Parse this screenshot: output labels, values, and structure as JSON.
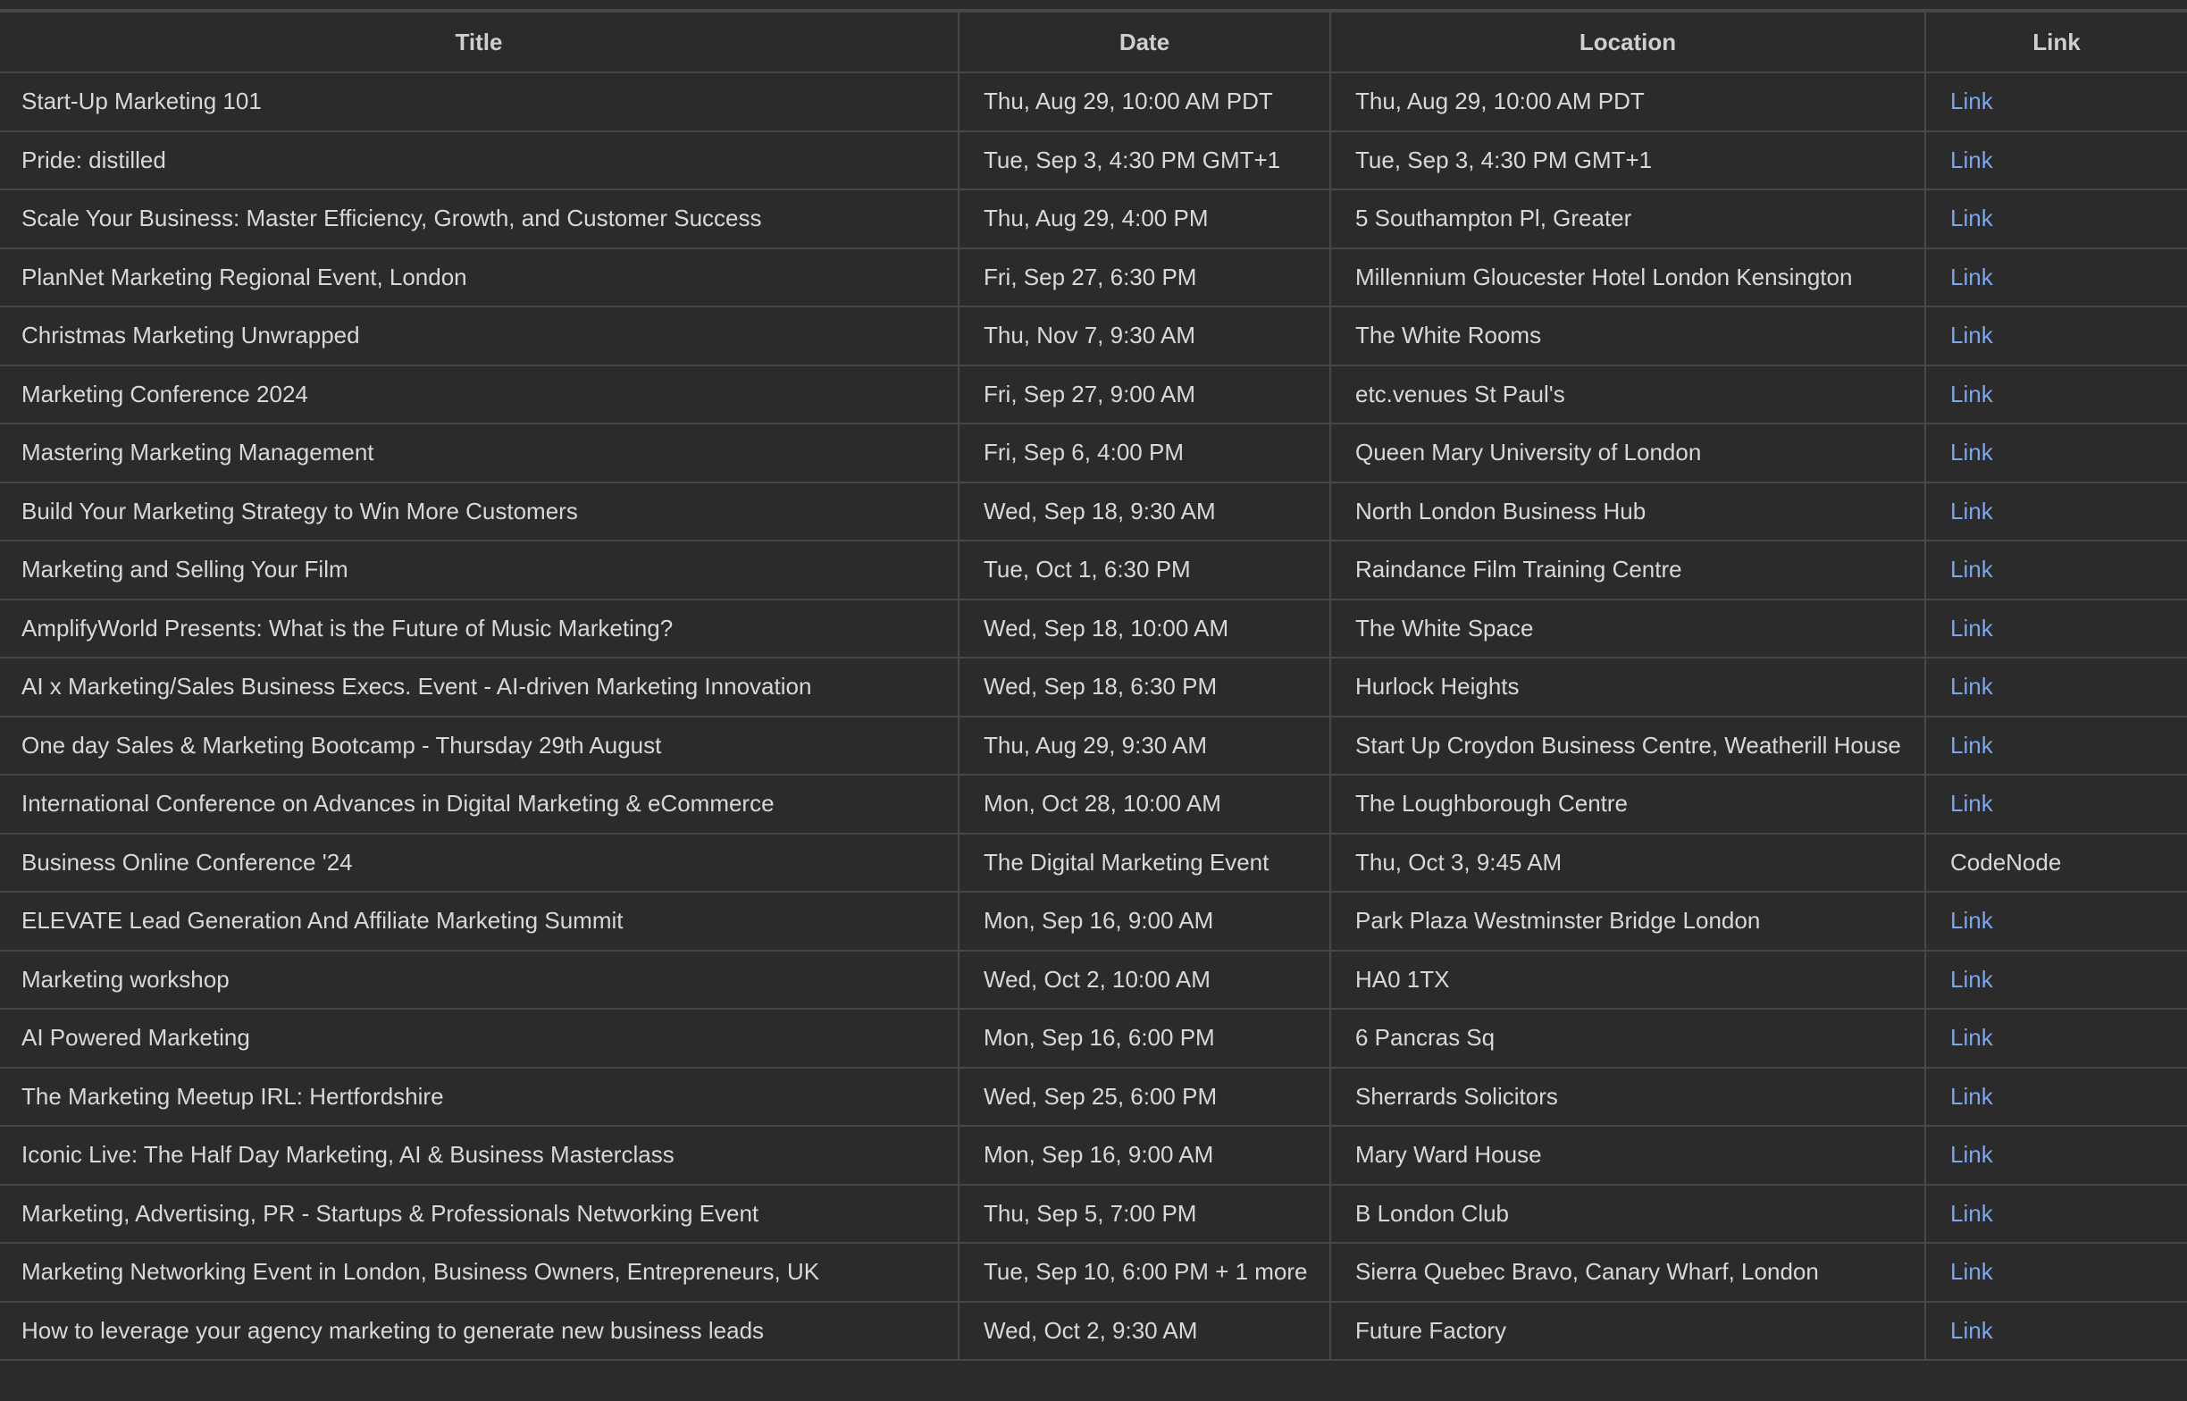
{
  "headers": {
    "title": "Title",
    "date": "Date",
    "location": "Location",
    "link": "Link"
  },
  "rows": [
    {
      "title": "Start-Up Marketing 101",
      "date": "Thu, Aug 29, 10:00 AM PDT",
      "location": "Thu, Aug 29, 10:00 AM PDT",
      "link": "Link",
      "is_link": true
    },
    {
      "title": "Pride: distilled",
      "date": "Tue, Sep 3, 4:30 PM GMT+1",
      "location": "Tue, Sep 3, 4:30 PM GMT+1",
      "link": "Link",
      "is_link": true
    },
    {
      "title": "Scale Your Business: Master Efficiency, Growth, and Customer Success",
      "date": "Thu, Aug 29, 4:00 PM",
      "location": "5 Southampton Pl, Greater",
      "link": "Link",
      "is_link": true
    },
    {
      "title": "PlanNet Marketing Regional Event, London",
      "date": "Fri, Sep 27, 6:30 PM",
      "location": "Millennium Gloucester Hotel London Kensington",
      "link": "Link",
      "is_link": true
    },
    {
      "title": "Christmas Marketing Unwrapped",
      "date": "Thu, Nov 7, 9:30 AM",
      "location": "The White Rooms",
      "link": "Link",
      "is_link": true
    },
    {
      "title": "Marketing Conference 2024",
      "date": "Fri, Sep 27, 9:00 AM",
      "location": "etc.venues St Paul's",
      "link": "Link",
      "is_link": true
    },
    {
      "title": "Mastering Marketing Management",
      "date": "Fri, Sep 6, 4:00 PM",
      "location": "Queen Mary University of London",
      "link": "Link",
      "is_link": true
    },
    {
      "title": "Build Your Marketing Strategy to Win More Customers",
      "date": "Wed, Sep 18, 9:30 AM",
      "location": "North London Business Hub",
      "link": "Link",
      "is_link": true
    },
    {
      "title": "Marketing and Selling Your Film",
      "date": "Tue, Oct 1, 6:30 PM",
      "location": "Raindance Film Training Centre",
      "link": "Link",
      "is_link": true
    },
    {
      "title": "AmplifyWorld Presents: What is the Future of Music Marketing?",
      "date": "Wed, Sep 18, 10:00 AM",
      "location": "The White Space",
      "link": "Link",
      "is_link": true
    },
    {
      "title": "AI x Marketing/Sales Business Execs. Event - AI-driven Marketing Innovation",
      "date": "Wed, Sep 18, 6:30 PM",
      "location": "Hurlock Heights",
      "link": "Link",
      "is_link": true
    },
    {
      "title": "One day Sales & Marketing Bootcamp - Thursday 29th August",
      "date": "Thu, Aug 29, 9:30 AM",
      "location": "Start Up Croydon Business Centre, Weatherill House",
      "link": "Link",
      "is_link": true
    },
    {
      "title": "International Conference on Advances in Digital Marketing & eCommerce",
      "date": "Mon, Oct 28, 10:00 AM",
      "location": "The Loughborough Centre",
      "link": "Link",
      "is_link": true
    },
    {
      "title": "Business Online Conference '24",
      "date": "The Digital Marketing Event",
      "location": "Thu, Oct 3, 9:45 AM",
      "link": "CodeNode",
      "is_link": false
    },
    {
      "title": "ELEVATE Lead Generation And Affiliate Marketing Summit",
      "date": "Mon, Sep 16, 9:00 AM",
      "location": "Park Plaza Westminster Bridge London",
      "link": "Link",
      "is_link": true
    },
    {
      "title": "Marketing workshop",
      "date": "Wed, Oct 2, 10:00 AM",
      "location": "HA0 1TX",
      "link": "Link",
      "is_link": true
    },
    {
      "title": "AI Powered Marketing",
      "date": "Mon, Sep 16, 6:00 PM",
      "location": "6 Pancras Sq",
      "link": "Link",
      "is_link": true
    },
    {
      "title": "The Marketing Meetup IRL: Hertfordshire",
      "date": "Wed, Sep 25, 6:00 PM",
      "location": "Sherrards Solicitors",
      "link": "Link",
      "is_link": true
    },
    {
      "title": "Iconic Live: The Half Day Marketing, AI & Business Masterclass",
      "date": "Mon, Sep 16, 9:00 AM",
      "location": "Mary Ward House",
      "link": "Link",
      "is_link": true
    },
    {
      "title": "Marketing, Advertising, PR - Startups & Professionals Networking Event",
      "date": "Thu, Sep 5, 7:00 PM",
      "location": "B London Club",
      "link": "Link",
      "is_link": true
    },
    {
      "title": "Marketing Networking Event in London, Business Owners, Entrepreneurs, UK",
      "date": "Tue, Sep 10, 6:00 PM + 1 more",
      "location": "Sierra Quebec Bravo, Canary Wharf, London",
      "link": "Link",
      "is_link": true
    },
    {
      "title": "How to leverage your agency marketing to generate new business leads",
      "date": "Wed, Oct 2, 9:30 AM",
      "location": "Future Factory",
      "link": "Link",
      "is_link": true
    }
  ],
  "colors": {
    "background": "#2b2b2b",
    "text": "#d8d8d8",
    "link": "#7aa7f2",
    "border": "#474747"
  }
}
